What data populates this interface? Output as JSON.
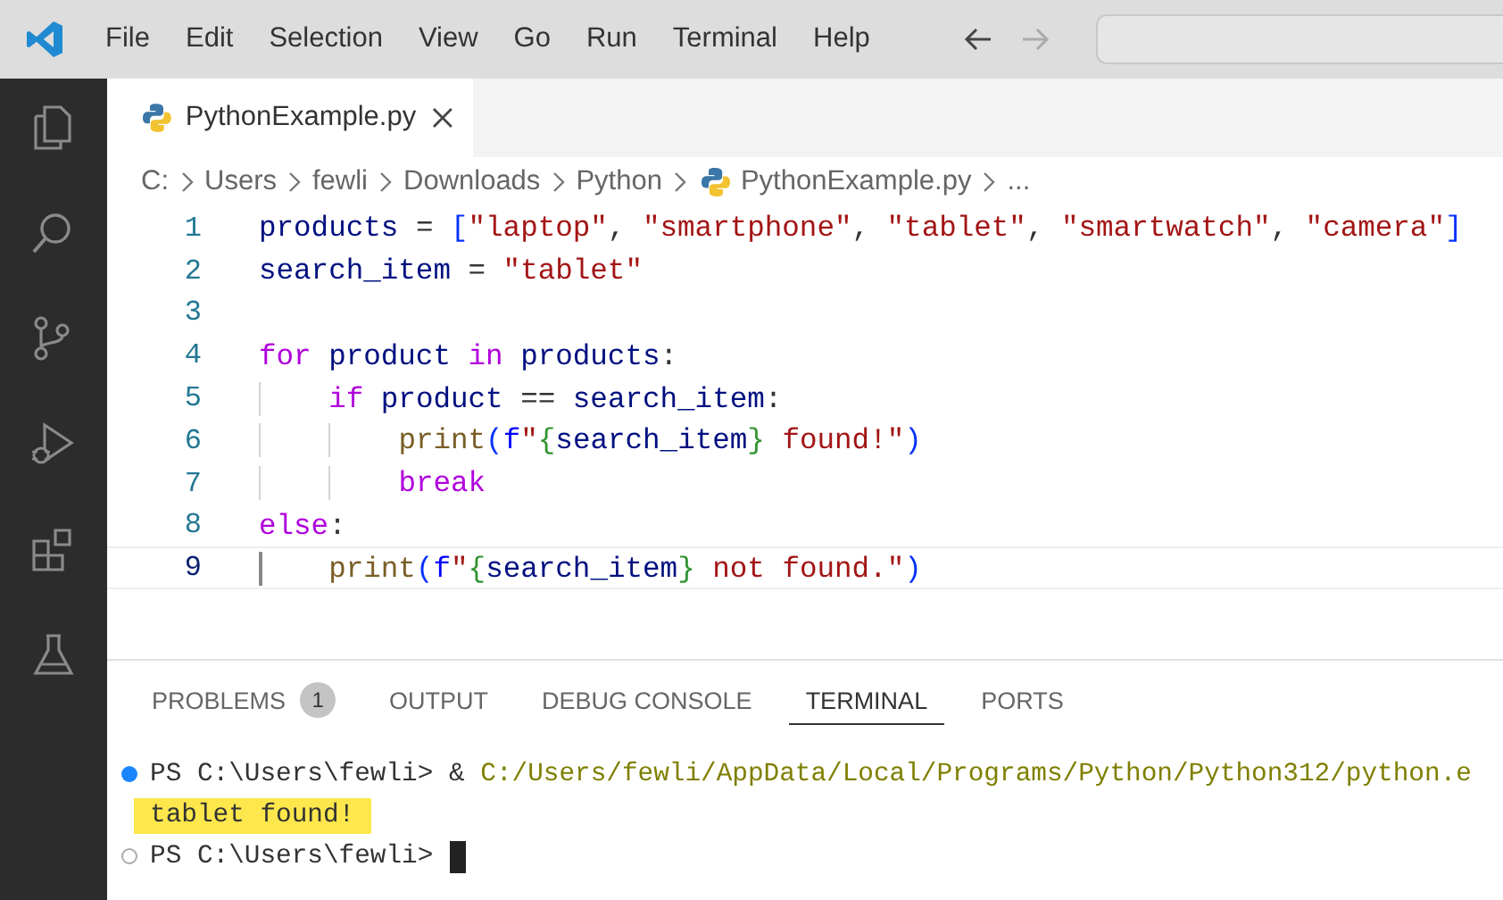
{
  "menu_bar": {
    "items": [
      "File",
      "Edit",
      "Selection",
      "View",
      "Go",
      "Run",
      "Terminal",
      "Help"
    ],
    "back_enabled": true,
    "forward_enabled": false
  },
  "activity_bar": {
    "icons": [
      {
        "kind": "files"
      },
      {
        "kind": "search"
      },
      {
        "kind": "source-control"
      },
      {
        "kind": "run-debug"
      },
      {
        "kind": "extensions"
      },
      {
        "kind": "testing"
      }
    ]
  },
  "editor_tabs": [
    {
      "label": "PythonExample.py",
      "selected": true
    }
  ],
  "breadcrumbs": [
    {
      "text": "C:",
      "kind": "folder"
    },
    {
      "text": "Users",
      "kind": "folder"
    },
    {
      "text": "fewli",
      "kind": "folder"
    },
    {
      "text": "Downloads",
      "kind": "folder"
    },
    {
      "text": "Python",
      "kind": "folder"
    },
    {
      "text": "PythonExample.py",
      "kind": "file"
    },
    {
      "text": "...",
      "kind": "more"
    }
  ],
  "editor": {
    "lines": [
      {
        "number": "1",
        "current": false,
        "tokens": [
          {
            "text": "products",
            "kind": "var"
          },
          {
            "text": " = ",
            "kind": "op"
          },
          {
            "text": "[",
            "kind": "br"
          },
          {
            "text": "\"laptop\"",
            "kind": "str"
          },
          {
            "text": ", ",
            "kind": "op"
          },
          {
            "text": "\"smartphone\"",
            "kind": "str"
          },
          {
            "text": ", ",
            "kind": "op"
          },
          {
            "text": "\"tablet\"",
            "kind": "str"
          },
          {
            "text": ", ",
            "kind": "op"
          },
          {
            "text": "\"smartwatch\"",
            "kind": "str"
          },
          {
            "text": ", ",
            "kind": "op"
          },
          {
            "text": "\"camera\"",
            "kind": "str"
          },
          {
            "text": "]",
            "kind": "br"
          }
        ]
      },
      {
        "number": "2",
        "current": false,
        "tokens": [
          {
            "text": "search_item",
            "kind": "var"
          },
          {
            "text": " = ",
            "kind": "op"
          },
          {
            "text": "\"tablet\"",
            "kind": "str"
          }
        ]
      },
      {
        "number": "3",
        "current": false
      },
      {
        "number": "4",
        "current": false,
        "tokens": [
          {
            "text": "for",
            "kind": "kw"
          },
          {
            "text": " product",
            "kind": "var"
          },
          {
            "text": " in",
            "kind": "kw"
          },
          {
            "text": " products",
            "kind": "var"
          },
          {
            "text": ":",
            "kind": "op"
          }
        ]
      },
      {
        "number": "5",
        "current": false,
        "tokens": [
          {
            "text": "    if",
            "kind": "kw"
          },
          {
            "text": " product",
            "kind": "var"
          },
          {
            "text": " == ",
            "kind": "op"
          },
          {
            "text": "search_item",
            "kind": "var"
          },
          {
            "text": ":",
            "kind": "op"
          }
        ]
      },
      {
        "number": "6",
        "current": false,
        "tokens": [
          {
            "text": "        print",
            "kind": "fn"
          },
          {
            "text": "(",
            "kind": "br"
          },
          {
            "text": "f",
            "kind": "storage"
          },
          {
            "text": "\"",
            "kind": "str"
          },
          {
            "text": "{",
            "kind": "br2"
          },
          {
            "text": "search_item",
            "kind": "var"
          },
          {
            "text": "}",
            "kind": "br2"
          },
          {
            "text": " found!\"",
            "kind": "str"
          },
          {
            "text": ")",
            "kind": "br"
          }
        ]
      },
      {
        "number": "7",
        "current": false,
        "tokens": [
          {
            "text": "        break",
            "kind": "kw"
          }
        ]
      },
      {
        "number": "8",
        "current": false,
        "tokens": [
          {
            "text": "else",
            "kind": "kw"
          },
          {
            "text": ":",
            "kind": "op"
          }
        ]
      },
      {
        "number": "9",
        "current": true,
        "tokens": [
          {
            "text": "    print",
            "kind": "fn"
          },
          {
            "text": "(",
            "kind": "br"
          },
          {
            "text": "f",
            "kind": "storage"
          },
          {
            "text": "\"",
            "kind": "str"
          },
          {
            "text": "{",
            "kind": "br2"
          },
          {
            "text": "search_item",
            "kind": "var"
          },
          {
            "text": "}",
            "kind": "br2"
          },
          {
            "text": " not found.\"",
            "kind": "str"
          },
          {
            "text": ")",
            "kind": "br"
          }
        ]
      }
    ]
  },
  "panel": {
    "tabs": [
      {
        "label": "PROBLEMS",
        "badge": "1",
        "selected": false
      },
      {
        "label": "OUTPUT",
        "selected": false
      },
      {
        "label": "DEBUG CONSOLE",
        "selected": false
      },
      {
        "label": "TERMINAL",
        "selected": true
      },
      {
        "label": "PORTS",
        "selected": false
      }
    ],
    "terminal_lines": [
      {
        "kind": "prompt",
        "completed": true,
        "prompt": "PS C:\\Users\\fewli>",
        "command": [
          {
            "text": "&",
            "kind": "op"
          },
          {
            "text": "C:/Users/fewli/AppData/Local/Programs/Python/Python312/python.e",
            "kind": "path"
          }
        ]
      },
      {
        "kind": "output",
        "text": "tablet found!",
        "highlighted": true
      },
      {
        "kind": "prompt",
        "completed": false,
        "prompt": "PS C:\\Users\\fewli>",
        "cursor": true
      }
    ]
  }
}
